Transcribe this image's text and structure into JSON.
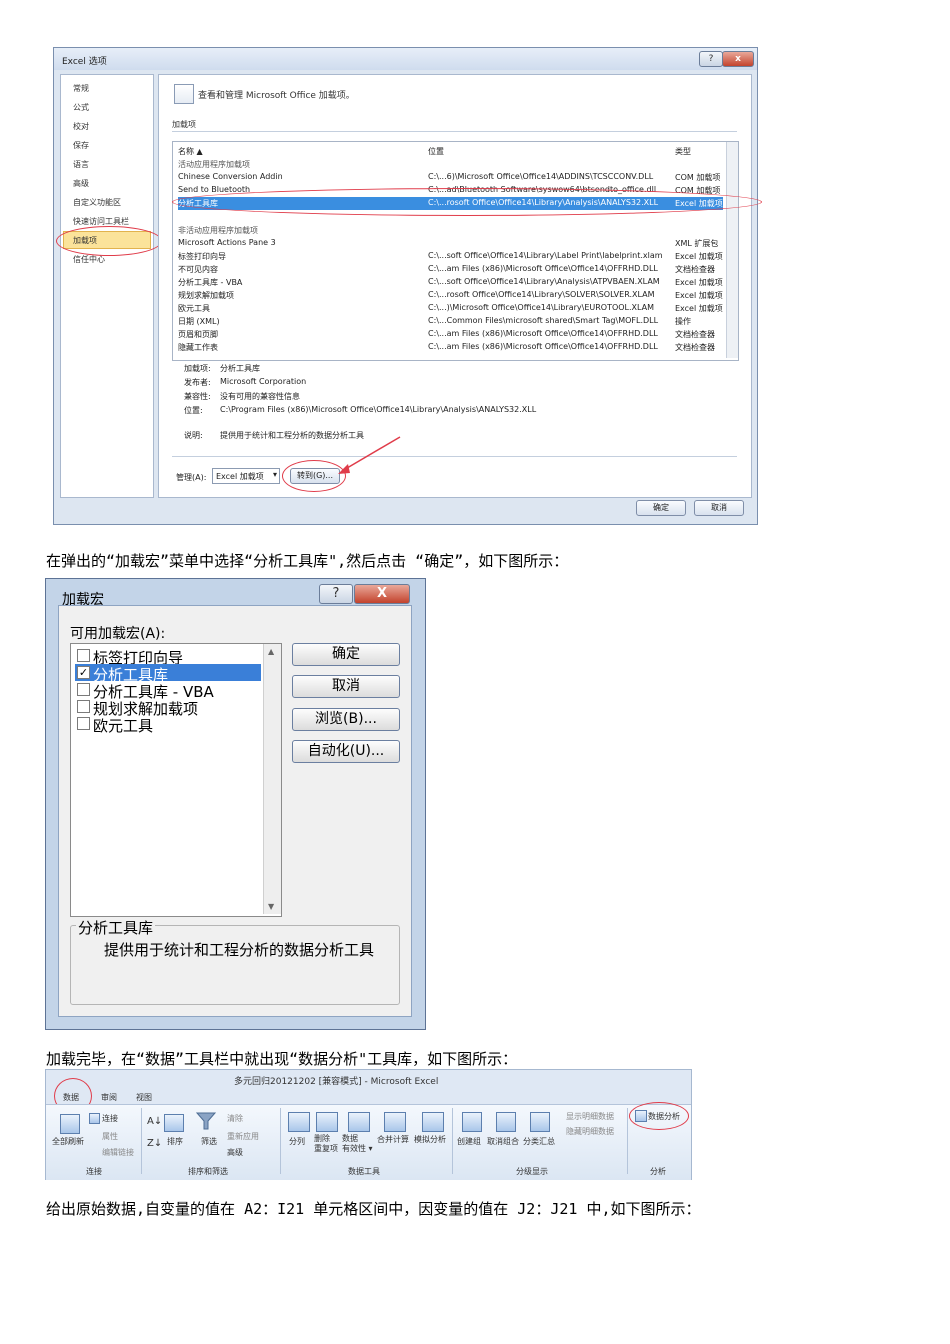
{
  "options_dialog": {
    "title": "Excel 选项",
    "help_btn": "?",
    "close_btn": "x",
    "nav": [
      "常规",
      "公式",
      "校对",
      "保存",
      "语言",
      "高级",
      "自定义功能区",
      "快速访问工具栏",
      "加载项",
      "信任中心"
    ],
    "header_text": "查看和管理 Microsoft Office 加载项。",
    "section": "加载项",
    "columns": {
      "name": "名称 ▲",
      "location": "位置",
      "type": "类型"
    },
    "active_group": "活动应用程序加载项",
    "active_rows": [
      {
        "name": "Chinese Conversion Addin",
        "loc": "C:\\...6)\\Microsoft Office\\Office14\\ADDINS\\TCSCCONV.DLL",
        "type": "COM 加载项"
      },
      {
        "name": "Send to Bluetooth",
        "loc": "C:\\...ad\\Bluetooth Software\\syswow64\\btsendto_office.dll",
        "type": "COM 加载项"
      },
      {
        "name": "分析工具库",
        "loc": "C:\\...rosoft Office\\Office14\\Library\\Analysis\\ANALYS32.XLL",
        "type": "Excel 加载项"
      }
    ],
    "inactive_group": "非活动应用程序加载项",
    "inactive_rows": [
      {
        "name": "Microsoft Actions Pane 3",
        "loc": "",
        "type": "XML 扩展包"
      },
      {
        "name": "标签打印向导",
        "loc": "C:\\...soft Office\\Office14\\Library\\Label Print\\labelprint.xlam",
        "type": "Excel 加载项"
      },
      {
        "name": "不可见内容",
        "loc": "C:\\...am Files (x86)\\Microsoft Office\\Office14\\OFFRHD.DLL",
        "type": "文档检查器"
      },
      {
        "name": "分析工具库 - VBA",
        "loc": "C:\\...soft Office\\Office14\\Library\\Analysis\\ATPVBAEN.XLAM",
        "type": "Excel 加载项"
      },
      {
        "name": "规划求解加载项",
        "loc": "C:\\...rosoft Office\\Office14\\Library\\SOLVER\\SOLVER.XLAM",
        "type": "Excel 加载项"
      },
      {
        "name": "欧元工具",
        "loc": "C:\\...)\\Microsoft Office\\Office14\\Library\\EUROTOOL.XLAM",
        "type": "Excel 加载项"
      },
      {
        "name": "日期 (XML)",
        "loc": "C:\\...Common Files\\microsoft shared\\Smart Tag\\MOFL.DLL",
        "type": "操作"
      },
      {
        "name": "页眉和页脚",
        "loc": "C:\\...am Files (x86)\\Microsoft Office\\Office14\\OFFRHD.DLL",
        "type": "文档检查器"
      },
      {
        "name": "隐藏工作表",
        "loc": "C:\\...am Files (x86)\\Microsoft Office\\Office14\\OFFRHD.DLL",
        "type": "文档检查器"
      }
    ],
    "details": {
      "addin_label": "加载项:",
      "addin": "分析工具库",
      "publisher_label": "发布者:",
      "publisher": "Microsoft Corporation",
      "compat_label": "兼容性:",
      "compat": "没有可用的兼容性信息",
      "loc_label": "位置:",
      "loc": "C:\\Program Files (x86)\\Microsoft Office\\Office14\\Library\\Analysis\\ANALYS32.XLL",
      "desc_label": "说明:",
      "desc": "提供用于统计和工程分析的数据分析工具"
    },
    "manage_label": "管理(A):",
    "manage_value": "Excel 加载项",
    "goto_btn": "转到(G)...",
    "ok_btn": "确定",
    "cancel_btn": "取消"
  },
  "para1": "在弹出的“加载宏”菜单中选择“分析工具库\",然后点击 “确定”，如下图所示：",
  "addin_dialog": {
    "title": "加载宏",
    "help_btn": "?",
    "close_btn": "X",
    "list_label": "可用加载宏(A):",
    "items": [
      {
        "label": "标签打印向导",
        "checked": ""
      },
      {
        "label": "分析工具库",
        "checked": "✓"
      },
      {
        "label": "分析工具库 - VBA",
        "checked": ""
      },
      {
        "label": "规划求解加载项",
        "checked": ""
      },
      {
        "label": "欧元工具",
        "checked": ""
      }
    ],
    "ok_btn": "确定",
    "cancel_btn": "取消",
    "browse_btn": "浏览(B)...",
    "automation_btn": "自动化(U)...",
    "group_title": "分析工具库",
    "group_desc": "提供用于统计和工程分析的数据分析工具"
  },
  "para2": "加载完毕，在“数据”工具栏中就出现“数据分析\"工具库，如下图所示：",
  "ribbon": {
    "title": "多元回归20121202 [兼容模式] - Microsoft Excel",
    "tabs": [
      "数据",
      "审阅",
      "视图"
    ],
    "conn": {
      "refresh": "全部刷新",
      "connections": "连接",
      "properties": "属性",
      "edit_links": "编辑链接",
      "group": "连接"
    },
    "sort": {
      "sort": "排序",
      "filter": "筛选",
      "clear": "清除",
      "reapply": "重新应用",
      "advanced": "高级",
      "group": "排序和筛选"
    },
    "tools": {
      "split": "分列",
      "dedupe": "删除\n重复项",
      "validation": "数据\n有效性 ▾",
      "consolidate": "合并计算",
      "whatif": "模拟分析",
      "group": "数据工具"
    },
    "outline": {
      "group_btn": "创建组",
      "ungroup": "取消组合",
      "subtotal": "分类汇总",
      "show": "显示明细数据",
      "hide": "隐藏明细数据",
      "group": "分级显示"
    },
    "analysis": {
      "data_analysis": "数据分析",
      "group": "分析"
    }
  },
  "para3": "给出原始数据,自变量的值在 A2：I21 单元格区间中，因变量的值在 J2：J21 中,如下图所示："
}
